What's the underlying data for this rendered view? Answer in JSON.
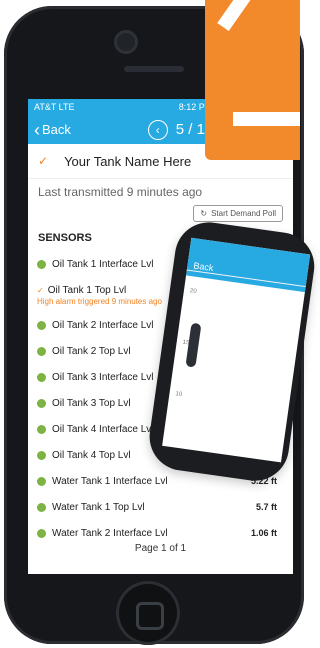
{
  "status": {
    "carrier": "AT&T  LTE",
    "time": "8:12 PM"
  },
  "nav": {
    "back": "Back",
    "pager": "5 / 10"
  },
  "tank": {
    "name": "Your Tank Name Here",
    "transmitted": "Last transmitted 9 minutes ago",
    "poll_button": "Start Demand Poll"
  },
  "sensors_heading": "SENSORS",
  "sensors": [
    {
      "label": "Oil Tank 1 Interface Lvl",
      "status": "normal",
      "value": ""
    },
    {
      "label": "Oil Tank 1 Top Lvl",
      "status": "high-alarm",
      "value": ""
    },
    {
      "label": "Oil Tank 2 Interface Lvl",
      "status": "normal",
      "value": ""
    },
    {
      "label": "Oil Tank 2 Top Lvl",
      "status": "normal",
      "value": ""
    },
    {
      "label": "Oil Tank 3 Interface Lvl",
      "status": "normal",
      "value": ""
    },
    {
      "label": "Oil Tank 3 Top Lvl",
      "status": "normal",
      "value": ""
    },
    {
      "label": "Oil Tank 4 Interface Lvl",
      "status": "normal",
      "value": ""
    },
    {
      "label": "Oil Tank 4 Top Lvl",
      "status": "normal",
      "value": ""
    },
    {
      "label": "Water Tank 1 Interface Lvl",
      "status": "normal",
      "value": "5.22 ft"
    },
    {
      "label": "Water Tank 1 Top Lvl",
      "status": "normal",
      "value": "5.7 ft"
    },
    {
      "label": "Water Tank 2 Interface Lvl",
      "status": "normal",
      "value": "1.06 ft"
    }
  ],
  "alarm_text": "High alarm triggered 9 minutes ago",
  "page_text": "Page 1 of 1",
  "tablet": {
    "back": "Back",
    "ticks": [
      "20",
      "15",
      "10"
    ]
  },
  "colors": {
    "accent": "#27a9e1",
    "orange": "#f58220",
    "green": "#7cb342"
  },
  "icons": [
    "check-icon",
    "chevron-left-icon",
    "chevron-right-icon",
    "refresh-icon"
  ]
}
